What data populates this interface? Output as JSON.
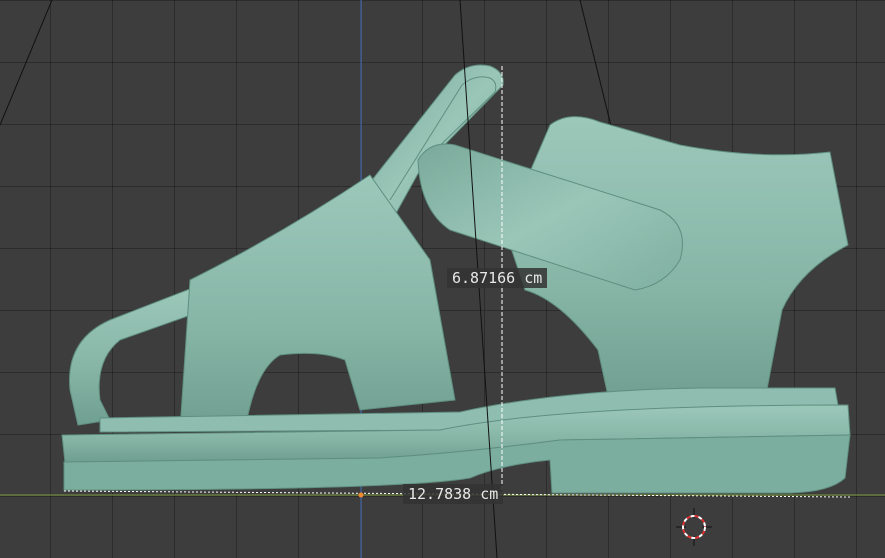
{
  "viewport": {
    "background": "#3d3d3d",
    "grid_color": "#2e2e2e",
    "y_axis_color": "#4a78c8",
    "x_axis_color": "#7a9a3a"
  },
  "model": {
    "name": "sandal",
    "color": "#86b5a6"
  },
  "measurements": {
    "height_label": "6.87166 cm",
    "length_label": "12.7838 cm"
  },
  "icons": {
    "cursor": "3d-cursor-icon"
  }
}
